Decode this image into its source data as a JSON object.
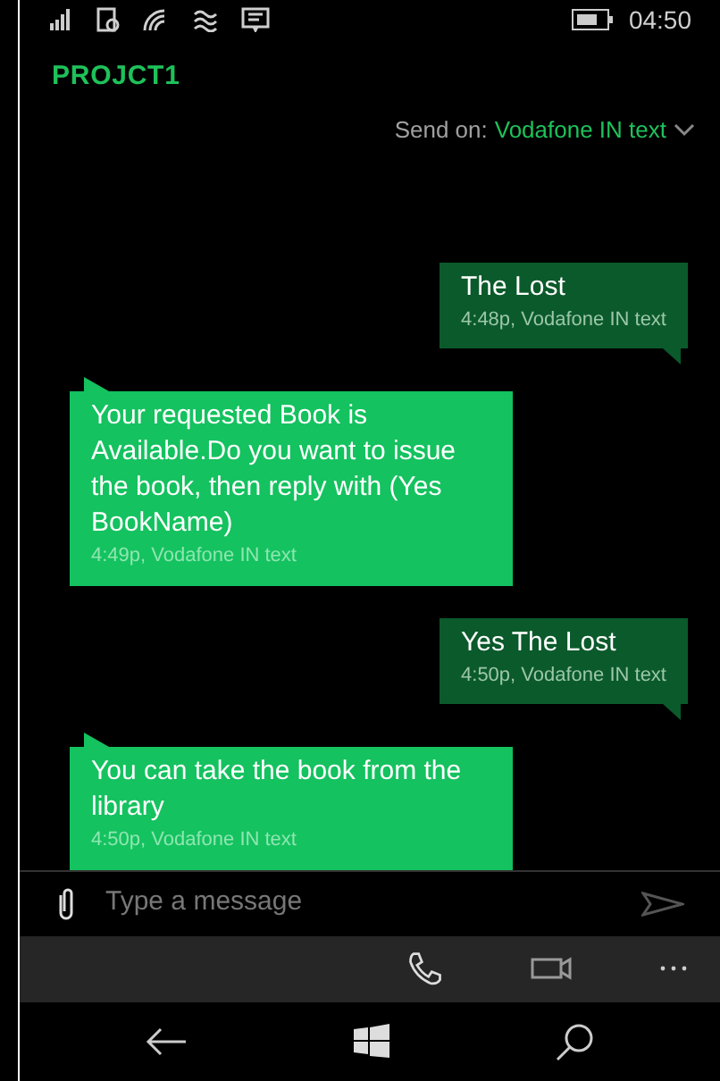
{
  "status_bar": {
    "time": "04:50"
  },
  "header": {
    "title": "PROJCT1",
    "send_on_label": "Send on:",
    "send_on_value": "Vodafone IN text"
  },
  "messages": [
    {
      "kind": "sent",
      "text": "The Lost",
      "meta": "4:48p, Vodafone IN text"
    },
    {
      "kind": "received",
      "text": "Your requested Book is Available.Do you want to issue the book, then reply with (Yes BookName)",
      "meta": "4:49p, Vodafone IN text"
    },
    {
      "kind": "sent",
      "text": "Yes The Lost",
      "meta": "4:50p, Vodafone IN text"
    },
    {
      "kind": "received",
      "text": "You can take the book from the library",
      "meta": "4:50p, Vodafone IN text"
    }
  ],
  "composer": {
    "placeholder": "Type a message"
  }
}
